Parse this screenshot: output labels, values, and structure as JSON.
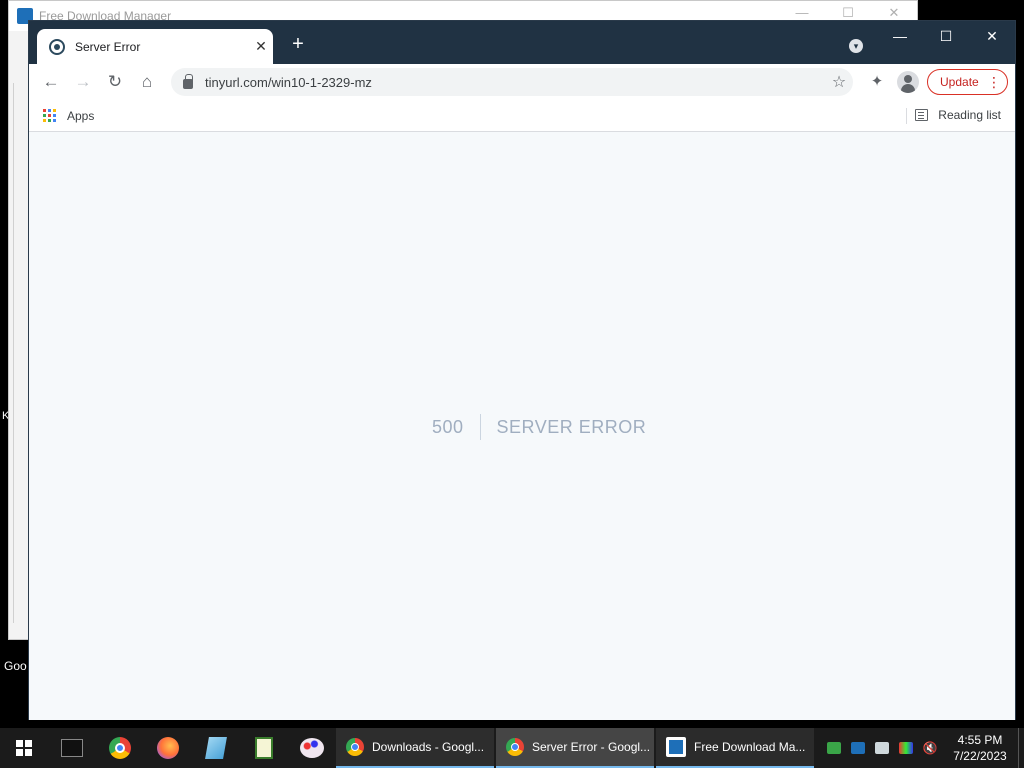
{
  "fdm_window": {
    "title": "Free Download Manager"
  },
  "desktop": {
    "label": "Goo",
    "letter": "K"
  },
  "browser": {
    "tab": {
      "title": "Server Error",
      "close": "✕"
    },
    "new_tab": "+",
    "window_controls": {
      "minimize": "—",
      "maximize": "☐",
      "close": "✕"
    },
    "toolbar": {
      "back": "←",
      "forward": "→",
      "reload": "↻",
      "home": "⌂",
      "url": "tinyurl.com/win10-1-2329-mz",
      "star": "☆",
      "extensions": "✦",
      "update_label": "Update",
      "menu": "⋮"
    },
    "bookmarks": {
      "apps_label": "Apps",
      "reading_list_label": "Reading list"
    },
    "page": {
      "error_code": "500",
      "error_message": "SERVER ERROR"
    }
  },
  "taskbar": {
    "tasks": [
      {
        "label": "Downloads - Googl..."
      },
      {
        "label": "Server Error - Googl..."
      },
      {
        "label": "Free Download Ma..."
      }
    ],
    "clock": {
      "time": "4:55 PM",
      "date": "7/22/2023"
    }
  },
  "colors": {
    "chrome_frame": "#203243",
    "page_background": "#f6f9fb",
    "error_text": "#a0aec0",
    "update_accent": "#d93025"
  },
  "icons": {
    "tray": [
      "network-icon",
      "fdm-tray-icon",
      "display-icon",
      "color-icon",
      "volume-muted-icon"
    ]
  }
}
